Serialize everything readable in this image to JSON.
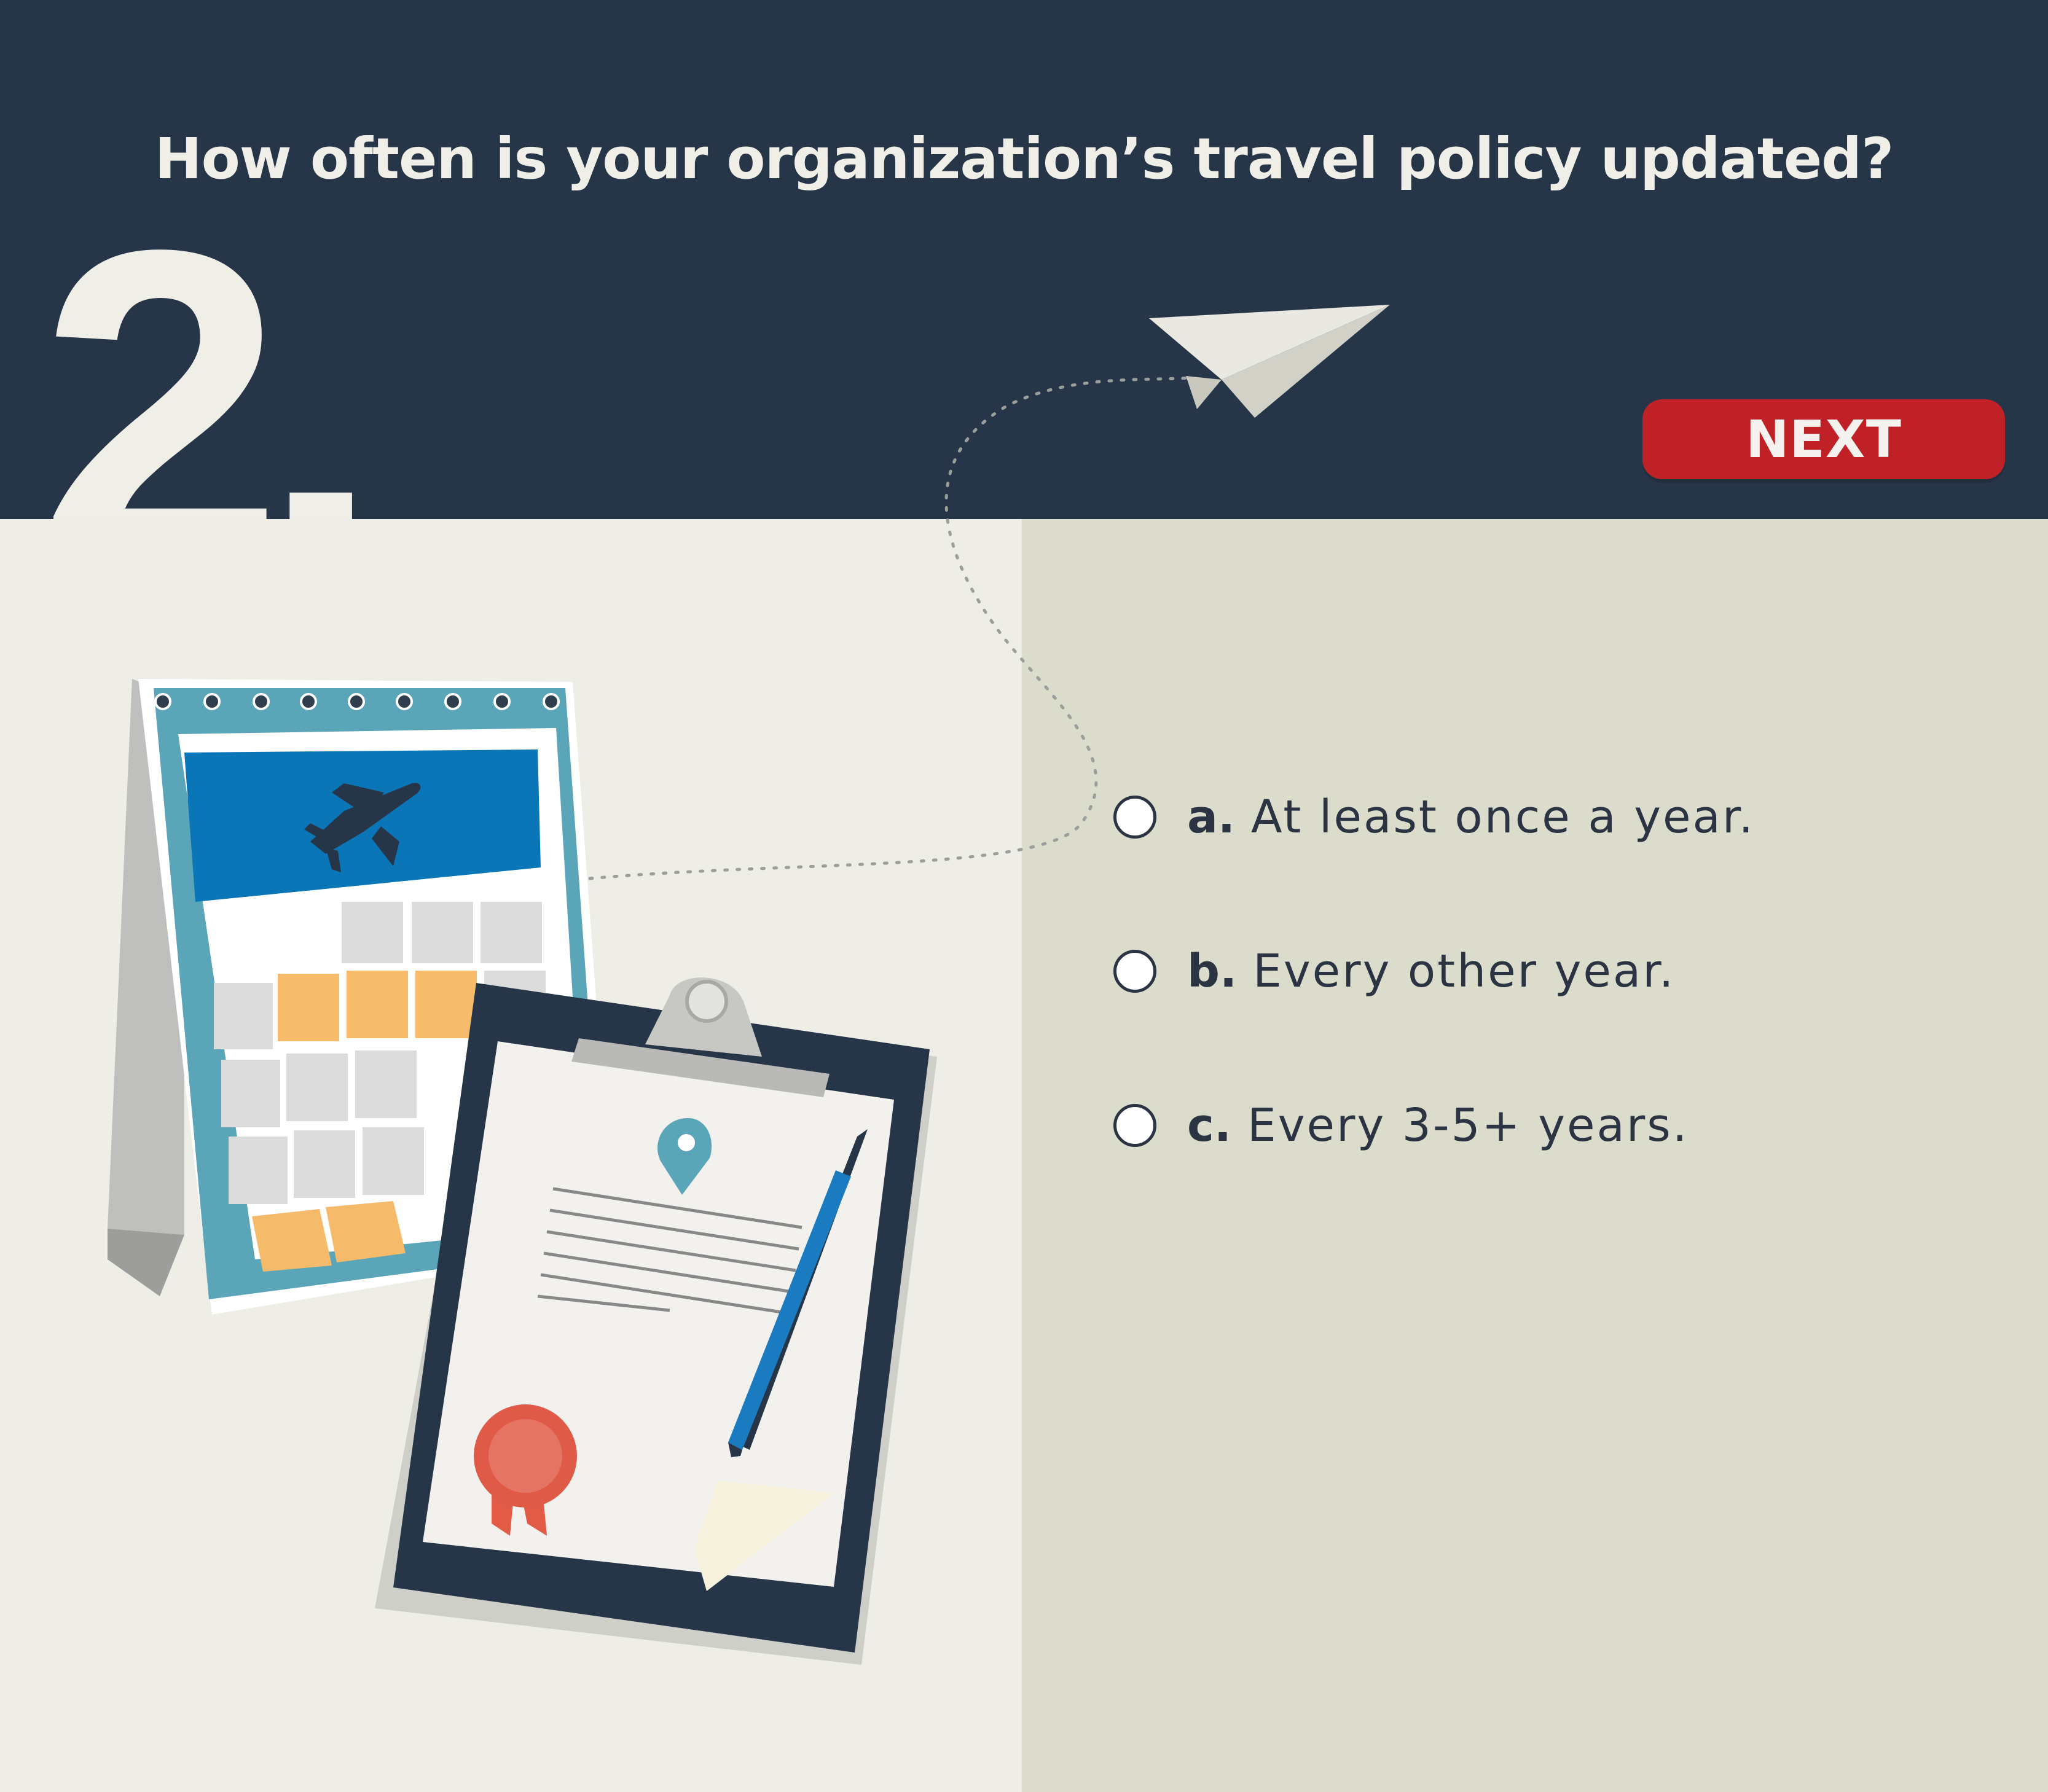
{
  "header": {
    "question": "How often is your organization’s travel policy updated?",
    "question_number": "2.",
    "next_label": "NEXT"
  },
  "options": [
    {
      "letter": "a.",
      "text": "At least once a year.",
      "selected": false
    },
    {
      "letter": "b.",
      "text": "Every other year.",
      "selected": false
    },
    {
      "letter": "c.",
      "text": "Every 3-5+ years.",
      "selected": false
    }
  ],
  "colors": {
    "header_bg": "#263547",
    "left_panel_bg": "#eeede6",
    "right_panel_bg": "#dbdccb",
    "accent_red": "#bf2126",
    "text_light": "#efefe8",
    "text_dark": "#2a3442"
  },
  "icons": [
    "paper-plane-icon",
    "calendar-icon",
    "airplane-icon",
    "clipboard-icon",
    "location-pin-icon",
    "pen-icon",
    "award-ribbon-icon"
  ]
}
